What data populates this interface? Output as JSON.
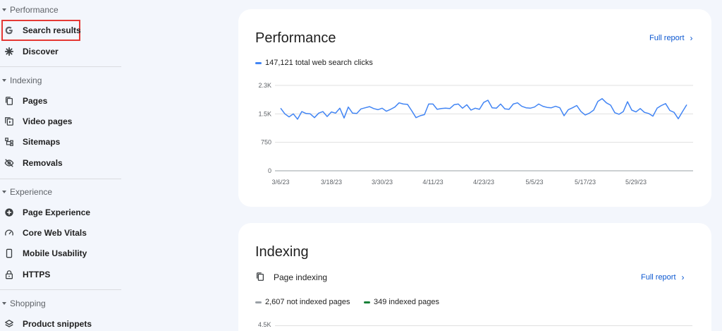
{
  "sidebar": {
    "sections": [
      {
        "label": "Performance",
        "items": [
          {
            "label": "Search results",
            "icon": "google-g-icon"
          },
          {
            "label": "Discover",
            "icon": "asterisk-icon"
          }
        ]
      },
      {
        "label": "Indexing",
        "items": [
          {
            "label": "Pages",
            "icon": "pages-icon"
          },
          {
            "label": "Video pages",
            "icon": "video-icon"
          },
          {
            "label": "Sitemaps",
            "icon": "sitemap-icon"
          },
          {
            "label": "Removals",
            "icon": "eye-off-icon"
          }
        ]
      },
      {
        "label": "Experience",
        "items": [
          {
            "label": "Page Experience",
            "icon": "plus-circle-icon"
          },
          {
            "label": "Core Web Vitals",
            "icon": "gauge-icon"
          },
          {
            "label": "Mobile Usability",
            "icon": "phone-icon"
          },
          {
            "label": "HTTPS",
            "icon": "lock-icon"
          }
        ]
      },
      {
        "label": "Shopping",
        "items": [
          {
            "label": "Product snippets",
            "icon": "layers-icon"
          }
        ]
      }
    ]
  },
  "performance": {
    "title": "Performance",
    "full_report": "Full report",
    "legend": "147,121 total web search clicks",
    "color": "#4285f4"
  },
  "indexing": {
    "title": "Indexing",
    "subtitle": "Page indexing",
    "full_report": "Full report",
    "legend_not_indexed": "2,607 not indexed pages",
    "legend_indexed": "349 indexed pages",
    "color_not_indexed": "#9aa0a6",
    "color_indexed": "#188038",
    "ytick_top": "4.5K"
  },
  "chart_data": {
    "type": "line",
    "yticks": [
      "0",
      "750",
      "1.5K",
      "2.3K"
    ],
    "ytick_values": [
      0,
      750,
      1500,
      2250
    ],
    "ylim": [
      0,
      2250
    ],
    "xticks": [
      "3/6/23",
      "3/18/23",
      "3/30/23",
      "4/11/23",
      "4/23/23",
      "5/5/23",
      "5/17/23",
      "5/29/23"
    ],
    "series": [
      {
        "values": [
          1650,
          1500,
          1420,
          1500,
          1360,
          1560,
          1510,
          1500,
          1400,
          1520,
          1560,
          1430,
          1550,
          1520,
          1650,
          1390,
          1680,
          1520,
          1510,
          1630,
          1660,
          1690,
          1640,
          1610,
          1650,
          1570,
          1620,
          1680,
          1790,
          1760,
          1750,
          1580,
          1400,
          1450,
          1480,
          1760,
          1760,
          1620,
          1640,
          1650,
          1640,
          1740,
          1760,
          1650,
          1740,
          1600,
          1650,
          1620,
          1800,
          1860,
          1660,
          1650,
          1760,
          1630,
          1620,
          1760,
          1790,
          1700,
          1660,
          1650,
          1680,
          1760,
          1700,
          1670,
          1660,
          1700,
          1660,
          1450,
          1610,
          1660,
          1720,
          1560,
          1470,
          1520,
          1600,
          1830,
          1900,
          1790,
          1730,
          1530,
          1490,
          1560,
          1820,
          1600,
          1550,
          1640,
          1540,
          1510,
          1440,
          1650,
          1720,
          1770,
          1590,
          1540,
          1370,
          1560,
          1740
        ]
      }
    ]
  }
}
